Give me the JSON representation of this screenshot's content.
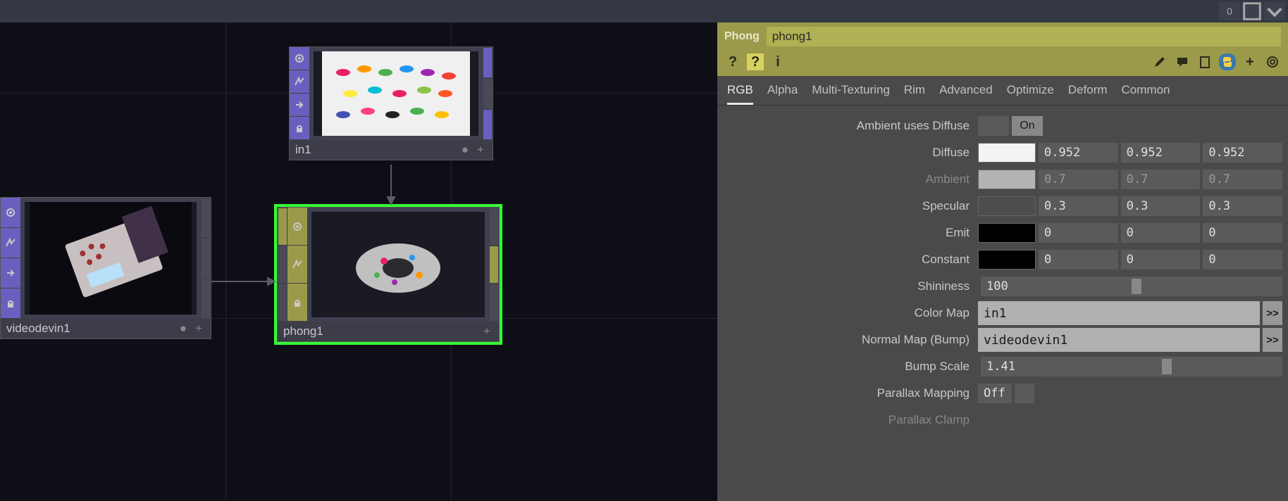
{
  "titlebar": {
    "buttons": [
      "0",
      "maximize",
      "collapse"
    ]
  },
  "nodes": {
    "in1": {
      "label": "in1"
    },
    "videodevin1": {
      "label": "videodevin1"
    },
    "phong1": {
      "label": "phong1"
    }
  },
  "panel": {
    "type": "Phong",
    "name": "phong1",
    "tabs": [
      "RGB",
      "Alpha",
      "Multi-Texturing",
      "Rim",
      "Advanced",
      "Optimize",
      "Deform",
      "Common"
    ],
    "activeTab": "RGB",
    "params": {
      "ambientUsesDiffuse": {
        "label": "Ambient uses Diffuse",
        "value": "On"
      },
      "diffuse": {
        "label": "Diffuse",
        "color": "#f3f3f3",
        "r": "0.952",
        "g": "0.952",
        "b": "0.952"
      },
      "ambient": {
        "label": "Ambient",
        "color": "#b3b3b3",
        "r": "0.7",
        "g": "0.7",
        "b": "0.7"
      },
      "specular": {
        "label": "Specular",
        "color": "#4d4d4d",
        "r": "0.3",
        "g": "0.3",
        "b": "0.3"
      },
      "emit": {
        "label": "Emit",
        "color": "#000000",
        "r": "0",
        "g": "0",
        "b": "0"
      },
      "constant": {
        "label": "Constant",
        "color": "#000000",
        "r": "0",
        "g": "0",
        "b": "0"
      },
      "shininess": {
        "label": "Shininess",
        "value": "100"
      },
      "colorMap": {
        "label": "Color Map",
        "value": "in1"
      },
      "normalMap": {
        "label": "Normal Map (Bump)",
        "value": "videodevin1"
      },
      "bumpScale": {
        "label": "Bump Scale",
        "value": "1.41"
      },
      "parallaxMapping": {
        "label": "Parallax Mapping",
        "value": "Off"
      },
      "parallaxClamp": {
        "label": "Parallax Clamp"
      }
    }
  }
}
